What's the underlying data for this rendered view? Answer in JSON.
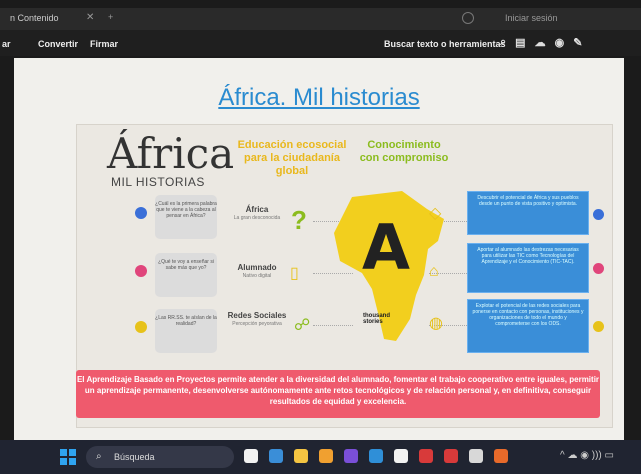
{
  "browser": {
    "tab_title": "n Contenido",
    "tab_close": "✕",
    "tab_new": "+",
    "session_label": "Iniciar sesión"
  },
  "toolbar": {
    "items": [
      "ar",
      "Convertir",
      "Firmar"
    ],
    "search_label": "Buscar texto o herramientas",
    "icons": [
      "search-icon",
      "print-icon",
      "cloud-icon",
      "share-icon",
      "pen-icon"
    ]
  },
  "document": {
    "title": "África. Mil historias",
    "slide": {
      "logo": "África",
      "logo_sub": "MIL HISTORIAS",
      "heading_1": "Educación ecosocial para la ciudadanía global",
      "heading_2": "Conocimiento con compromiso",
      "questions": [
        {
          "text": "¿Cuál es la primera palabra que te viene a la cabeza al pensar en África?",
          "topic": "África",
          "topic_sub": "La gran desconocida",
          "color": "#3a6fd8"
        },
        {
          "text": "¿Qué te voy a enseñar si sabe más que yo?",
          "topic": "Alumnado",
          "topic_sub": "Nativo digital",
          "color": "#e0457b"
        },
        {
          "text": "¿Las RR.SS. te aíslan de la realidad?",
          "topic": "Redes Sociales",
          "topic_sub": "Percepción peyorativa",
          "color": "#e7c21a"
        }
      ],
      "map_letter": "A",
      "map_caption": "thousand stories",
      "right_boxes": [
        {
          "text": "Descubrir el potencial de África y sus pueblos desde un punto de vista positivo y optimista.",
          "dot": "#3a6fd8"
        },
        {
          "text": "Aportar al alumnado las destrezas necesarias para utilizar las TIC como Tecnologías del Aprendizaje y el Conocimiento (TIC-TAC).",
          "dot": "#e0457b"
        },
        {
          "text": "Explotar el potencial de las redes sociales para ponerse en contacto con personas, instituciones y organizaciones de todo el mundo y comprometerse con los ODS.",
          "dot": "#e7c21a"
        }
      ],
      "banner": "El Aprendizaje Basado en Proyectos permite atender a la diversidad del alumnado, fomentar el trabajo cooperativo entre iguales, permitir un aprendizaje permanente, desenvolverse autónomamente ante retos tecnológicos y de relación personal y, en definitiva, conseguir resultados de equidad y excelencia."
    }
  },
  "taskbar": {
    "search_placeholder": "Búsqueda",
    "apps": [
      "#f2f2f2",
      "#3a8ed8",
      "#f5c542",
      "#f0a030",
      "#7a4fd8",
      "#2f8fd8",
      "#f2f2f2",
      "#d83a3a",
      "#d83a3a",
      "#d8d8d8",
      "#e86a2a"
    ],
    "tray": "^ ☁ ◉ ))) ▭"
  }
}
